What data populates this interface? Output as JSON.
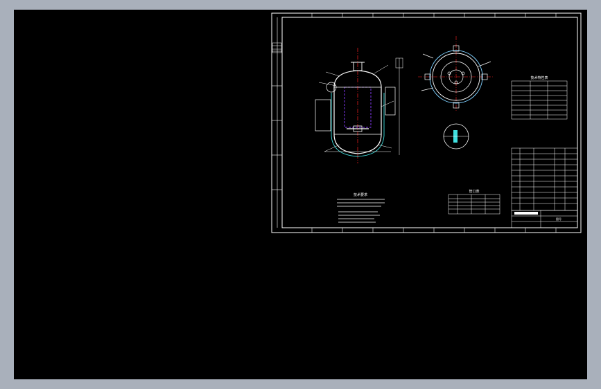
{
  "app": {
    "background_color": "#a9b0bb",
    "viewport_color": "#000000",
    "line_color": "#ffffff",
    "accent_colors": {
      "centerline": "#ff2020",
      "hidden_line": "#8a3cff",
      "dimension": "#7fd0ff",
      "cyan": "#40e0e0"
    }
  },
  "drawing": {
    "notes_title": "技术要求",
    "parts_table_title": "管口表",
    "spec_table_title": "技术特性表",
    "title_block_label": "图号"
  }
}
